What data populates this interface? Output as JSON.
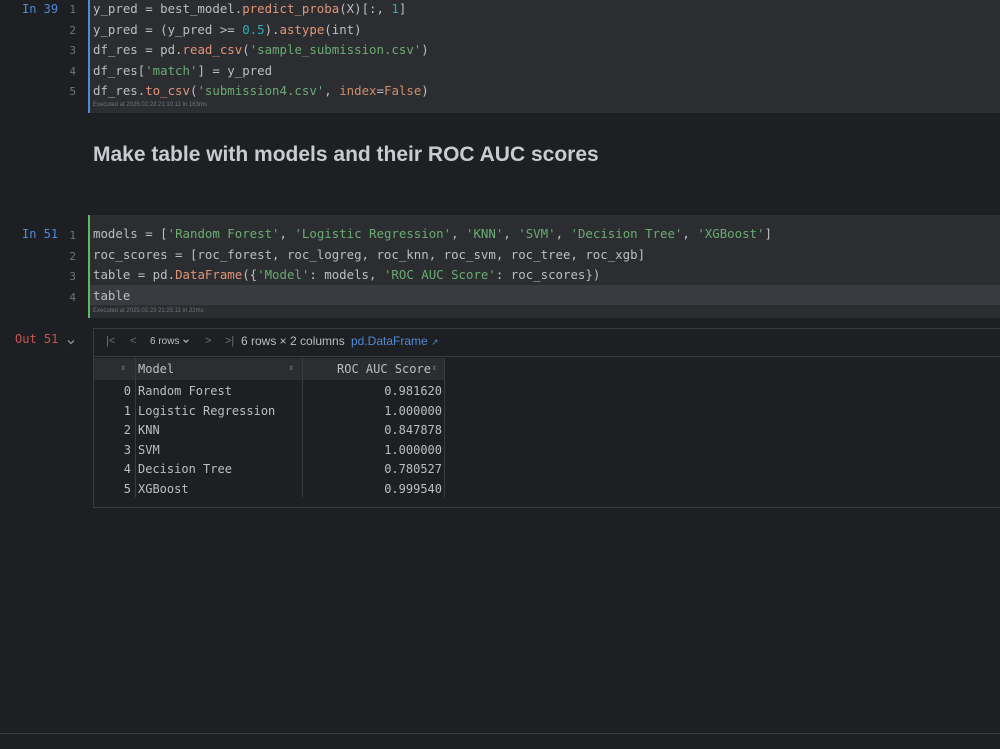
{
  "cell39": {
    "prompt": "In 39",
    "line_numbers": [
      "1",
      "2",
      "3",
      "4",
      "5"
    ],
    "code": [
      [
        {
          "t": "y_pred = best_model.",
          "c": ""
        },
        {
          "t": "predict_proba",
          "c": "fn"
        },
        {
          "t": "(X)[:, ",
          "c": ""
        },
        {
          "t": "1",
          "c": "num"
        },
        {
          "t": "]",
          "c": ""
        }
      ],
      [
        {
          "t": "y_pred = (y_pred >= ",
          "c": ""
        },
        {
          "t": "0.5",
          "c": "num"
        },
        {
          "t": ").",
          "c": ""
        },
        {
          "t": "astype",
          "c": "fn"
        },
        {
          "t": "(int)",
          "c": ""
        }
      ],
      [
        {
          "t": "df_res = pd.",
          "c": ""
        },
        {
          "t": "read_csv",
          "c": "fn"
        },
        {
          "t": "(",
          "c": ""
        },
        {
          "t": "'sample_submission.csv'",
          "c": "str"
        },
        {
          "t": ")",
          "c": ""
        }
      ],
      [
        {
          "t": "df_res[",
          "c": ""
        },
        {
          "t": "'match'",
          "c": "str"
        },
        {
          "t": "] = y_pred",
          "c": ""
        }
      ],
      [
        {
          "t": "df_res.",
          "c": ""
        },
        {
          "t": "to_csv",
          "c": "fn"
        },
        {
          "t": "(",
          "c": ""
        },
        {
          "t": "'submission4.csv'",
          "c": "str"
        },
        {
          "t": ", ",
          "c": ""
        },
        {
          "t": "index",
          "c": "kw"
        },
        {
          "t": "=",
          "c": ""
        },
        {
          "t": "False",
          "c": "kw"
        },
        {
          "t": ")",
          "c": ""
        }
      ]
    ],
    "executed": "Executed at 2025.02.23 21:10:11 in 163ms"
  },
  "markdown": {
    "title": "Make table with models and their ROC AUC scores"
  },
  "cell51": {
    "prompt": "In 51",
    "line_numbers": [
      "1",
      "2",
      "3",
      "4"
    ],
    "code": [
      [
        {
          "t": "models = [",
          "c": ""
        },
        {
          "t": "'Random Forest'",
          "c": "str"
        },
        {
          "t": ", ",
          "c": ""
        },
        {
          "t": "'Logistic Regression'",
          "c": "str"
        },
        {
          "t": ", ",
          "c": ""
        },
        {
          "t": "'KNN'",
          "c": "str"
        },
        {
          "t": ", ",
          "c": ""
        },
        {
          "t": "'SVM'",
          "c": "str"
        },
        {
          "t": ", ",
          "c": ""
        },
        {
          "t": "'Decision Tree'",
          "c": "str"
        },
        {
          "t": ", ",
          "c": ""
        },
        {
          "t": "'XGBoost'",
          "c": "str"
        },
        {
          "t": "]",
          "c": ""
        }
      ],
      [
        {
          "t": "roc_scores = [roc_forest, roc_logreg, roc_knn, roc_svm, roc_tree, roc_xgb]",
          "c": ""
        }
      ],
      [
        {
          "t": "table = pd.",
          "c": ""
        },
        {
          "t": "DataFrame",
          "c": "fn"
        },
        {
          "t": "({",
          "c": ""
        },
        {
          "t": "'Model'",
          "c": "str"
        },
        {
          "t": ": models, ",
          "c": ""
        },
        {
          "t": "'ROC AUC Score'",
          "c": "str"
        },
        {
          "t": ": roc_scores})",
          "c": ""
        }
      ],
      [
        {
          "t": "table",
          "c": ""
        }
      ]
    ],
    "executed": "Executed at 2025.02.23 21:25:11 in 22ms"
  },
  "output": {
    "prompt": "Out 51",
    "toolbar": {
      "first": "|<",
      "prev": "<",
      "rows_select": "6 rows",
      "next": ">",
      "last": ">|",
      "summary": "6 rows × 2 columns",
      "type_link": "pd.DataFrame",
      "open_icon": "↗"
    },
    "columns": [
      "Model",
      "ROC AUC Score"
    ],
    "rows": [
      {
        "idx": "0",
        "model": "Random Forest",
        "score": "0.981620"
      },
      {
        "idx": "1",
        "model": "Logistic Regression",
        "score": "1.000000"
      },
      {
        "idx": "2",
        "model": "KNN",
        "score": "0.847878"
      },
      {
        "idx": "3",
        "model": "SVM",
        "score": "1.000000"
      },
      {
        "idx": "4",
        "model": "Decision Tree",
        "score": "0.780527"
      },
      {
        "idx": "5",
        "model": "XGBoost",
        "score": "0.999540"
      }
    ]
  },
  "colors": {
    "accent_blue": "#4e8ad6",
    "running_green": "#5fb865",
    "error_red": "#c75450"
  }
}
